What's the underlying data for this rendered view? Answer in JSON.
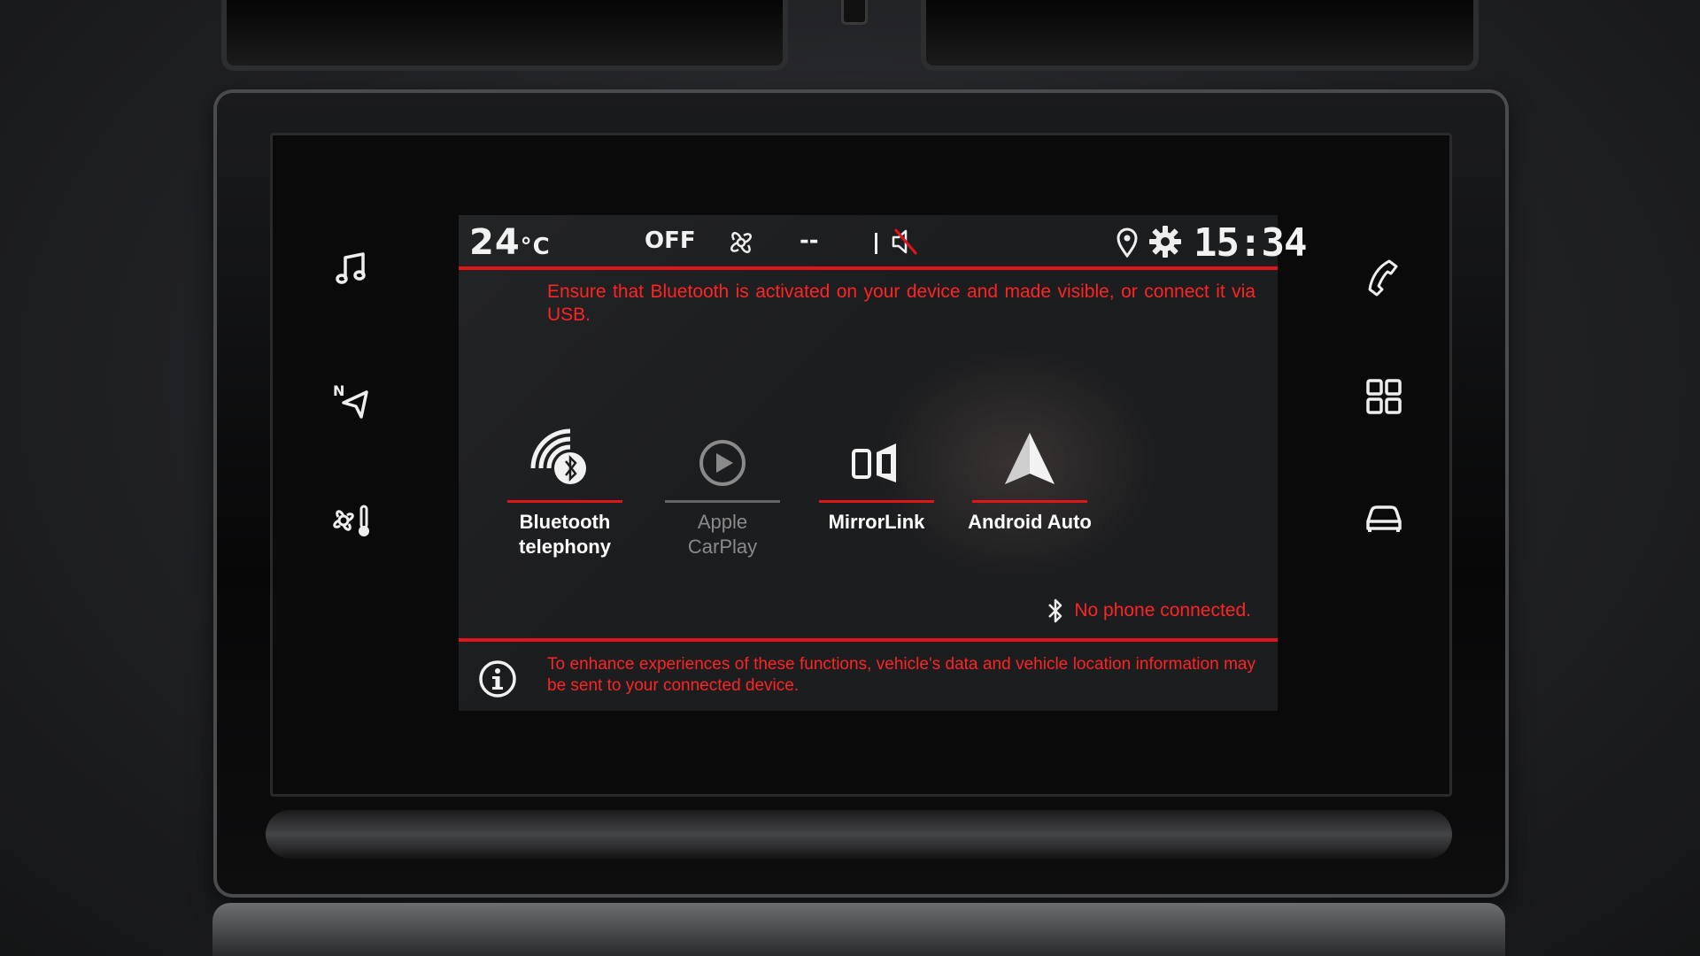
{
  "status_bar": {
    "temperature": "24",
    "temperature_unit": "°C",
    "ac_state": "OFF",
    "fan_level": "--",
    "time": "15:34"
  },
  "connect_screen": {
    "instruction": "Ensure that Bluetooth is activated on your device and made visible, or connect it via USB.",
    "apps": [
      {
        "label": "Bluetooth telephony",
        "icon": "bluetooth-telephony-icon",
        "enabled": true
      },
      {
        "label": "Apple CarPlay",
        "icon": "play-circle-icon",
        "enabled": false
      },
      {
        "label": "MirrorLink",
        "icon": "mirrorlink-icon",
        "enabled": true
      },
      {
        "label": "Android Auto",
        "icon": "android-auto-icon",
        "enabled": true
      }
    ],
    "connection_status": "No phone connected.",
    "info_message": "To enhance experiences of these functions, vehicle's data and vehicle location information may be sent to your connected device."
  },
  "side_buttons": {
    "left": [
      "music-note-icon",
      "navigation-icon",
      "climate-icon"
    ],
    "right": [
      "phone-icon",
      "apps-grid-icon",
      "car-icon"
    ]
  },
  "colors": {
    "accent_red": "#e0151b",
    "text_red": "#ff2424",
    "background": "#1c1d1f",
    "disabled_grey": "#8a8a8a"
  }
}
